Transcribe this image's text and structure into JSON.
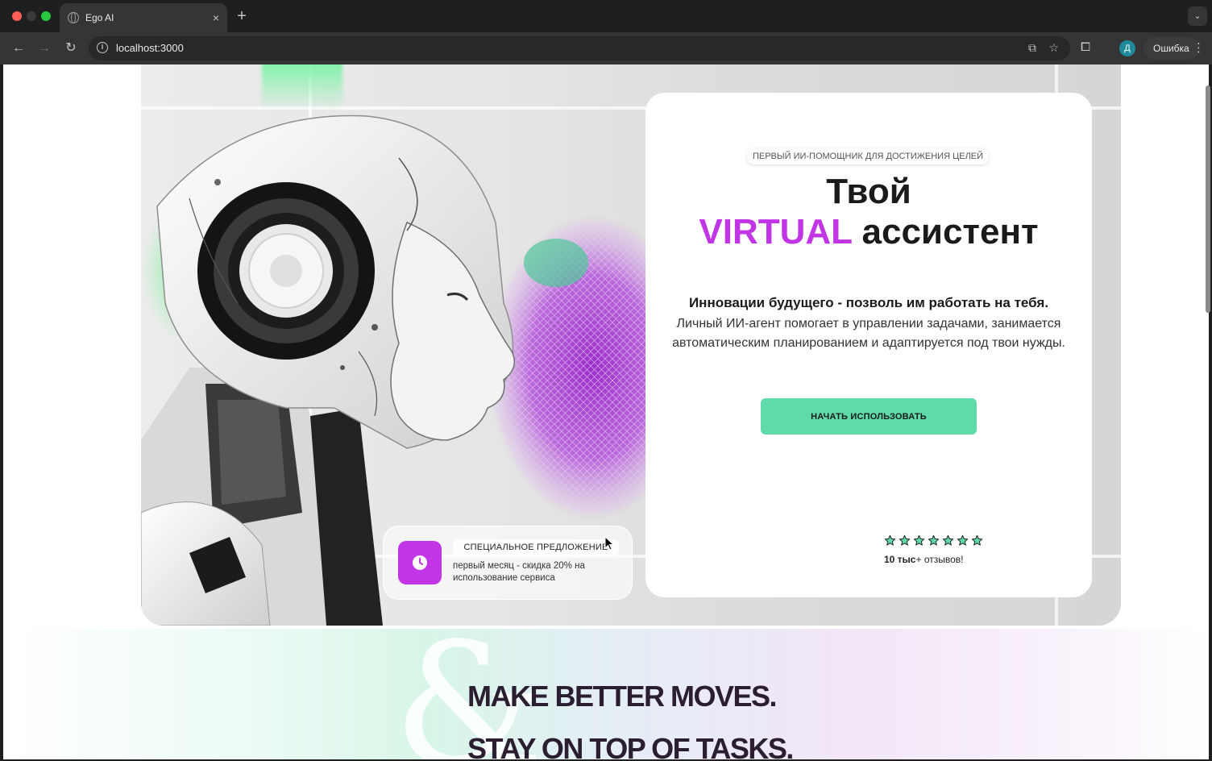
{
  "browser": {
    "tab_title": "Ego AI",
    "new_tab": "+",
    "tab_close": "×",
    "url": "localhost:3000",
    "profile_initial": "Д",
    "error_label": "Ошибка"
  },
  "hero": {
    "badge": "ПЕРВЫЙ ИИ-ПОМОЩНИК ДЛЯ ДОСТИЖЕНИЯ ЦЕЛЕЙ",
    "title_line1": "Твой",
    "title_accent": "VIRTUAL",
    "title_rest": "ассистент",
    "lead": "Инновации будущего - позволь им работать на тебя.",
    "description": "Личный ИИ-агент помогает в управлении задачами, занимается автоматическим планированием и адаптируется под твои нужды.",
    "cta_label": "НАЧАТЬ ИСПОЛЬЗОВАТЬ",
    "rating_stars": 7,
    "reviews_count": "10 тыс",
    "reviews_suffix": "+ отзывов!",
    "accent_color": "#c235e6",
    "cta_color": "#5fdaa9"
  },
  "promo": {
    "badge": "СПЕЦИАЛЬНОЕ ПРЕДЛОЖЕНИЕ",
    "text": "первый месяц - скидка 20% на использование сервиса",
    "icon": "clock-icon"
  },
  "section2": {
    "decoration": "&",
    "line1": "MAKE BETTER MOVES.",
    "line2": "STAY ON TOP OF TASKS."
  }
}
